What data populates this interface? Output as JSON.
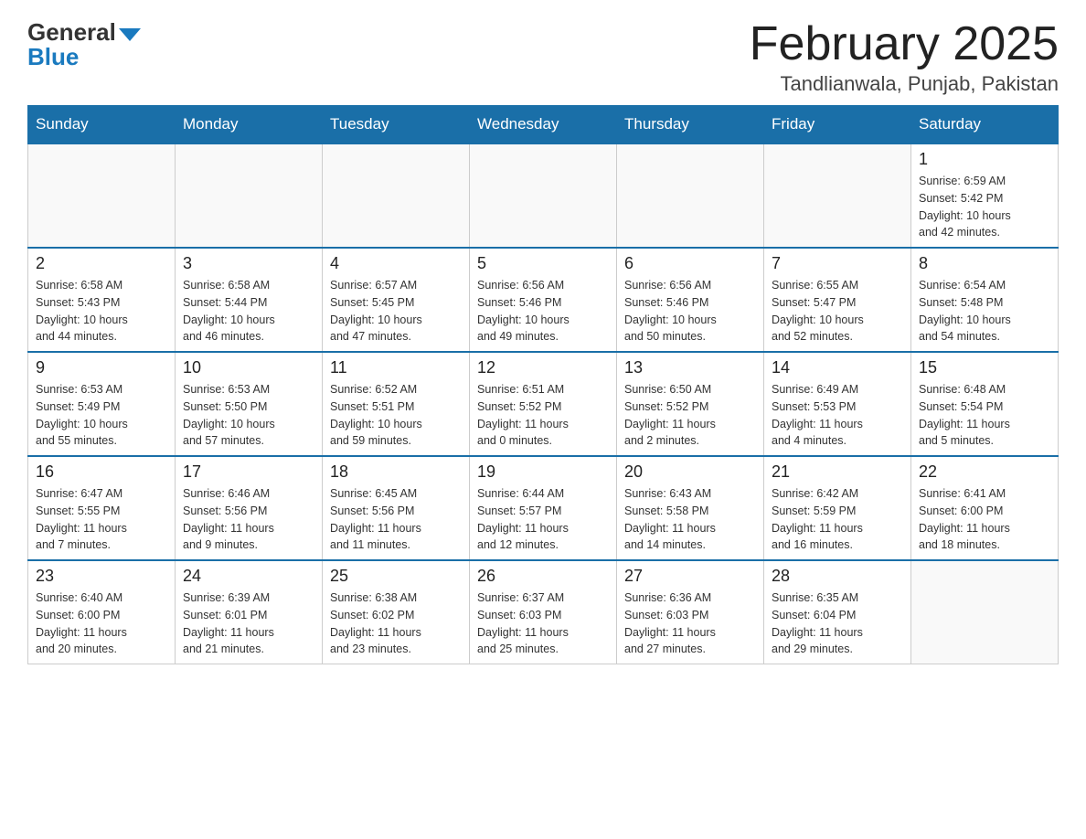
{
  "logo": {
    "general": "General",
    "blue": "Blue"
  },
  "title": "February 2025",
  "location": "Tandlianwala, Punjab, Pakistan",
  "weekdays": [
    "Sunday",
    "Monday",
    "Tuesday",
    "Wednesday",
    "Thursday",
    "Friday",
    "Saturday"
  ],
  "weeks": [
    [
      {
        "day": "",
        "info": ""
      },
      {
        "day": "",
        "info": ""
      },
      {
        "day": "",
        "info": ""
      },
      {
        "day": "",
        "info": ""
      },
      {
        "day": "",
        "info": ""
      },
      {
        "day": "",
        "info": ""
      },
      {
        "day": "1",
        "info": "Sunrise: 6:59 AM\nSunset: 5:42 PM\nDaylight: 10 hours\nand 42 minutes."
      }
    ],
    [
      {
        "day": "2",
        "info": "Sunrise: 6:58 AM\nSunset: 5:43 PM\nDaylight: 10 hours\nand 44 minutes."
      },
      {
        "day": "3",
        "info": "Sunrise: 6:58 AM\nSunset: 5:44 PM\nDaylight: 10 hours\nand 46 minutes."
      },
      {
        "day": "4",
        "info": "Sunrise: 6:57 AM\nSunset: 5:45 PM\nDaylight: 10 hours\nand 47 minutes."
      },
      {
        "day": "5",
        "info": "Sunrise: 6:56 AM\nSunset: 5:46 PM\nDaylight: 10 hours\nand 49 minutes."
      },
      {
        "day": "6",
        "info": "Sunrise: 6:56 AM\nSunset: 5:46 PM\nDaylight: 10 hours\nand 50 minutes."
      },
      {
        "day": "7",
        "info": "Sunrise: 6:55 AM\nSunset: 5:47 PM\nDaylight: 10 hours\nand 52 minutes."
      },
      {
        "day": "8",
        "info": "Sunrise: 6:54 AM\nSunset: 5:48 PM\nDaylight: 10 hours\nand 54 minutes."
      }
    ],
    [
      {
        "day": "9",
        "info": "Sunrise: 6:53 AM\nSunset: 5:49 PM\nDaylight: 10 hours\nand 55 minutes."
      },
      {
        "day": "10",
        "info": "Sunrise: 6:53 AM\nSunset: 5:50 PM\nDaylight: 10 hours\nand 57 minutes."
      },
      {
        "day": "11",
        "info": "Sunrise: 6:52 AM\nSunset: 5:51 PM\nDaylight: 10 hours\nand 59 minutes."
      },
      {
        "day": "12",
        "info": "Sunrise: 6:51 AM\nSunset: 5:52 PM\nDaylight: 11 hours\nand 0 minutes."
      },
      {
        "day": "13",
        "info": "Sunrise: 6:50 AM\nSunset: 5:52 PM\nDaylight: 11 hours\nand 2 minutes."
      },
      {
        "day": "14",
        "info": "Sunrise: 6:49 AM\nSunset: 5:53 PM\nDaylight: 11 hours\nand 4 minutes."
      },
      {
        "day": "15",
        "info": "Sunrise: 6:48 AM\nSunset: 5:54 PM\nDaylight: 11 hours\nand 5 minutes."
      }
    ],
    [
      {
        "day": "16",
        "info": "Sunrise: 6:47 AM\nSunset: 5:55 PM\nDaylight: 11 hours\nand 7 minutes."
      },
      {
        "day": "17",
        "info": "Sunrise: 6:46 AM\nSunset: 5:56 PM\nDaylight: 11 hours\nand 9 minutes."
      },
      {
        "day": "18",
        "info": "Sunrise: 6:45 AM\nSunset: 5:56 PM\nDaylight: 11 hours\nand 11 minutes."
      },
      {
        "day": "19",
        "info": "Sunrise: 6:44 AM\nSunset: 5:57 PM\nDaylight: 11 hours\nand 12 minutes."
      },
      {
        "day": "20",
        "info": "Sunrise: 6:43 AM\nSunset: 5:58 PM\nDaylight: 11 hours\nand 14 minutes."
      },
      {
        "day": "21",
        "info": "Sunrise: 6:42 AM\nSunset: 5:59 PM\nDaylight: 11 hours\nand 16 minutes."
      },
      {
        "day": "22",
        "info": "Sunrise: 6:41 AM\nSunset: 6:00 PM\nDaylight: 11 hours\nand 18 minutes."
      }
    ],
    [
      {
        "day": "23",
        "info": "Sunrise: 6:40 AM\nSunset: 6:00 PM\nDaylight: 11 hours\nand 20 minutes."
      },
      {
        "day": "24",
        "info": "Sunrise: 6:39 AM\nSunset: 6:01 PM\nDaylight: 11 hours\nand 21 minutes."
      },
      {
        "day": "25",
        "info": "Sunrise: 6:38 AM\nSunset: 6:02 PM\nDaylight: 11 hours\nand 23 minutes."
      },
      {
        "day": "26",
        "info": "Sunrise: 6:37 AM\nSunset: 6:03 PM\nDaylight: 11 hours\nand 25 minutes."
      },
      {
        "day": "27",
        "info": "Sunrise: 6:36 AM\nSunset: 6:03 PM\nDaylight: 11 hours\nand 27 minutes."
      },
      {
        "day": "28",
        "info": "Sunrise: 6:35 AM\nSunset: 6:04 PM\nDaylight: 11 hours\nand 29 minutes."
      },
      {
        "day": "",
        "info": ""
      }
    ]
  ]
}
